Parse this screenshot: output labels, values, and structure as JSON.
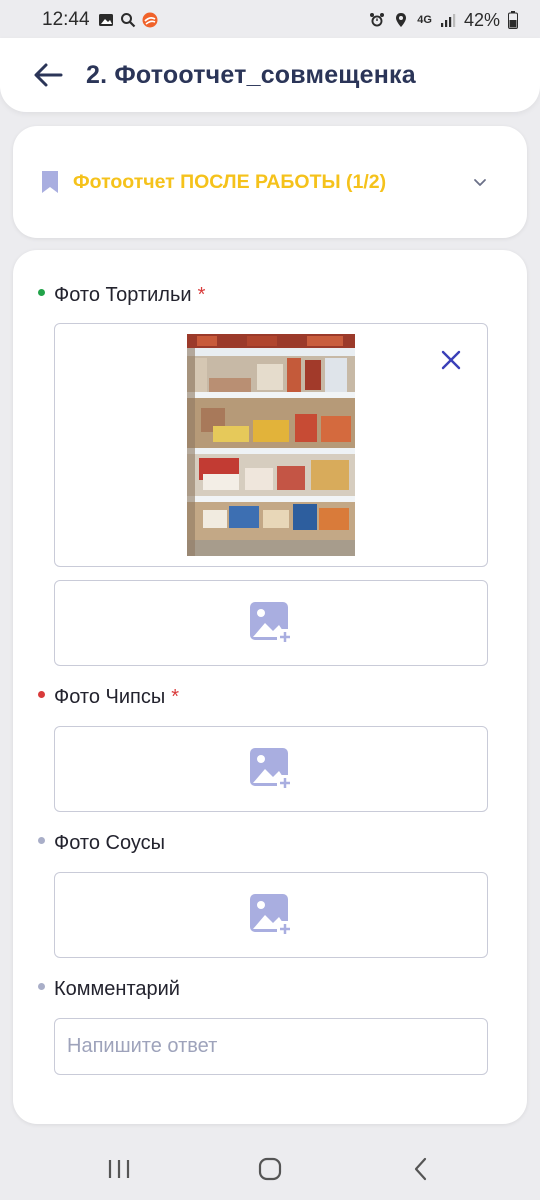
{
  "status_bar": {
    "time": "12:44",
    "network": "4G",
    "battery": "42%",
    "left_icons": [
      "image-icon",
      "search-icon",
      "app-icon"
    ],
    "right_icons": [
      "alarm-icon",
      "location-icon",
      "network-icon",
      "signal-icon",
      "battery-icon"
    ]
  },
  "header": {
    "title": "2. Фотоотчет_совмещенка",
    "back_icon": "arrow-left-icon"
  },
  "section": {
    "title": "Фотоотчет ПОСЛЕ РАБОТЫ (1/2)",
    "icon": "bookmark-icon",
    "chevron": "chevron-down-icon"
  },
  "form": {
    "fields": [
      {
        "label": "Фото Тортильи",
        "required": true,
        "dot_color": "#22a34a",
        "required_mark": "*"
      },
      {
        "label": "Фото Чипсы",
        "required": true,
        "dot_color": "#d93b3b",
        "required_mark": "*"
      },
      {
        "label": "Фото Соусы",
        "required": false,
        "dot_color": "#a9aec8"
      },
      {
        "label": "Комментарий",
        "required": false,
        "dot_color": "#a9aec8"
      }
    ],
    "comment_placeholder": "Напишите ответ"
  },
  "colors": {
    "accent_yellow": "#f5c21b",
    "title_navy": "#2b3558",
    "remove_x": "#3a3fb8",
    "icon_lavender": "#a9aee0"
  },
  "nav": {
    "recent_icon": "recent-apps-icon",
    "home_icon": "home-icon",
    "back_icon": "back-icon"
  }
}
